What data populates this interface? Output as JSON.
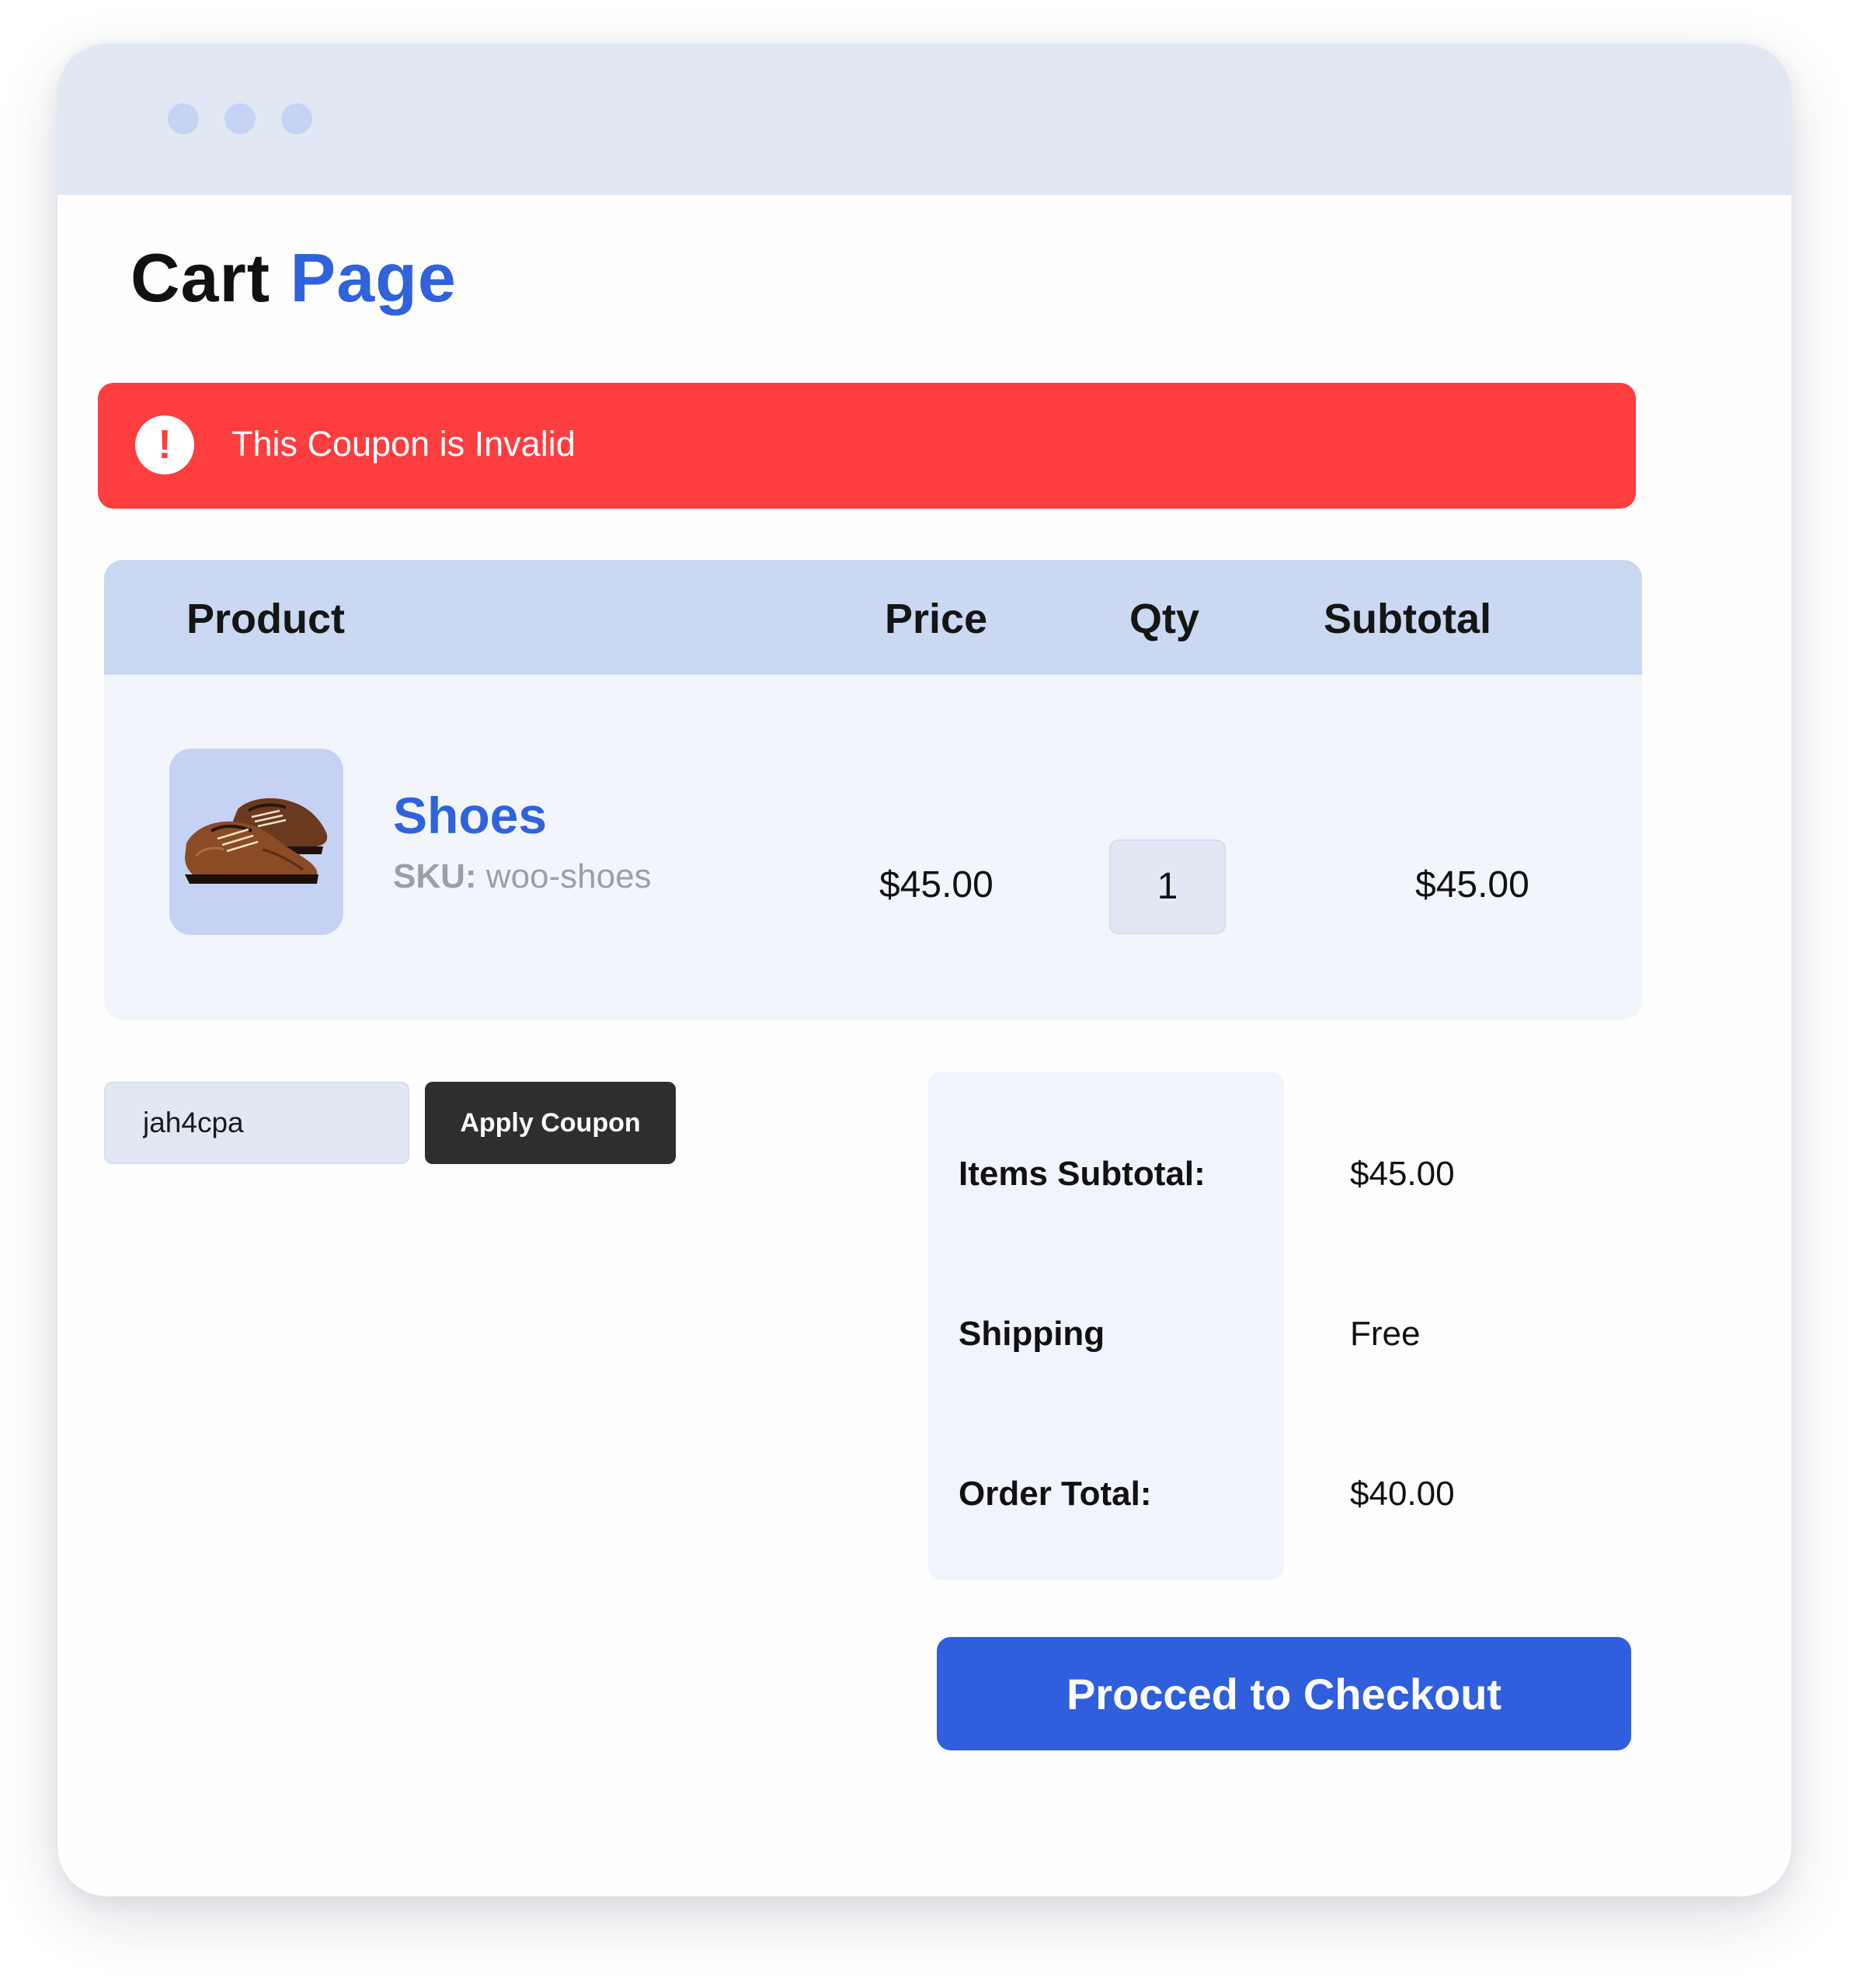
{
  "page": {
    "title_main": "Cart",
    "title_accent": "Page"
  },
  "alert": {
    "icon": "exclamation-icon",
    "icon_glyph": "!",
    "message": "This Coupon is Invalid",
    "color": "#fe3d3f"
  },
  "table": {
    "headers": {
      "product": "Product",
      "price": "Price",
      "qty": "Qty",
      "subtotal": "Subtotal"
    },
    "rows": [
      {
        "image": "shoes-image",
        "name": "Shoes",
        "sku_label": "SKU:",
        "sku": "woo-shoes",
        "price": "$45.00",
        "qty": "1",
        "subtotal": "$45.00"
      }
    ]
  },
  "coupon": {
    "value": "jah4cpa",
    "apply_label": "Apply Coupon"
  },
  "totals": {
    "items_subtotal_label": "Items Subtotal:",
    "items_subtotal_value": "$45.00",
    "shipping_label": "Shipping",
    "shipping_value": "Free",
    "order_total_label": "Order Total:",
    "order_total_value": "$40.00"
  },
  "checkout": {
    "label": "Procced to Checkout"
  },
  "colors": {
    "accent": "#3062dc",
    "checkout": "#2f5fdd",
    "error": "#fe3d3f",
    "header_bg": "#cbd8f2",
    "titlebar": "#e1e8f4"
  }
}
